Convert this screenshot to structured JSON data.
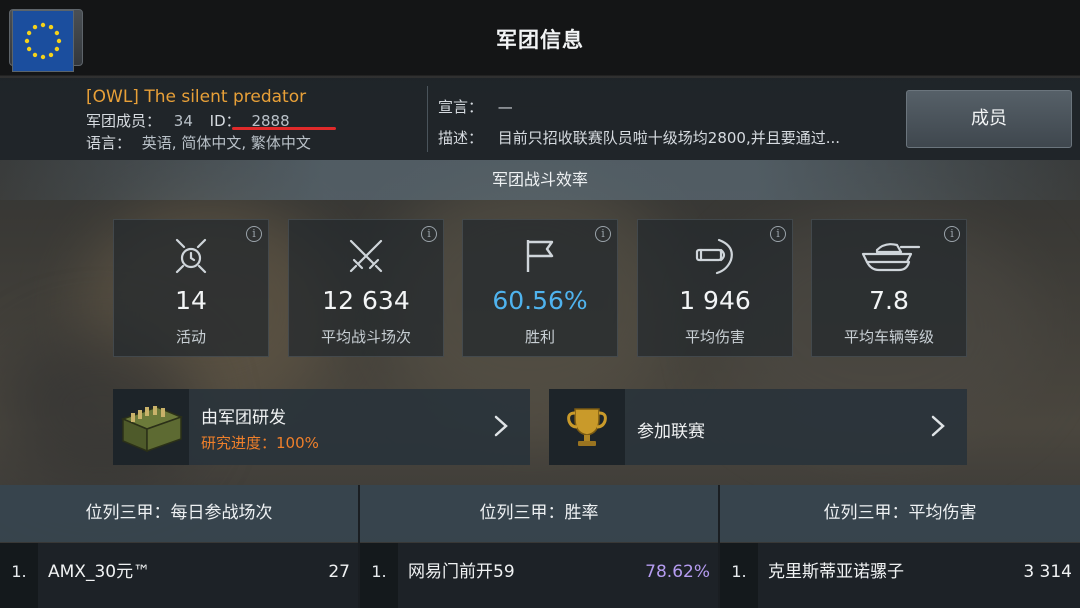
{
  "header": {
    "title": "军团信息"
  },
  "clan": {
    "name": "[OWL] The silent predator",
    "members_label": "军团成员：",
    "members_value": "34",
    "id_label": "ID：",
    "id_value": "2888",
    "language_label": "语言：",
    "language_value": "英语, 简体中文, 繁体中文",
    "declaration_label": "宣言：",
    "declaration_value": "—",
    "description_label": "描述：",
    "description_value": "目前只招收联赛队员啦十级场均2800,并且要通过..."
  },
  "members_button": "成员",
  "section_title": "军团战斗效率",
  "stats": [
    {
      "value": "14",
      "label": "活动",
      "icon": "activity-icon"
    },
    {
      "value": "12 634",
      "label": "平均战斗场次",
      "icon": "crossed-swords-icon"
    },
    {
      "value": "60.56%",
      "label": "胜利",
      "icon": "flag-icon"
    },
    {
      "value": "1 946",
      "label": "平均伤害",
      "icon": "shell-shield-icon"
    },
    {
      "value": "7.8",
      "label": "平均车辆等级",
      "icon": "tank-icon"
    }
  ],
  "info_glyph": "i",
  "research": {
    "title": "由军团研发",
    "progress": "研究进度：100%"
  },
  "league": {
    "title": "参加联赛"
  },
  "leaderboards": [
    {
      "title": "位列三甲：每日参战场次",
      "rank": "1.",
      "name": "AMX_30元™",
      "score": "27"
    },
    {
      "title": "位列三甲：胜率",
      "rank": "1.",
      "name": "网易门前开59",
      "score": "78.62%"
    },
    {
      "title": "位列三甲：平均伤害",
      "rank": "1.",
      "name": "克里斯蒂亚诺骡子",
      "score": "3 314"
    }
  ],
  "colors": {
    "clan_name": "#e8a038",
    "win_rate": "#4fb3ee",
    "research_progress": "#ef7f2a",
    "winrate_score": "#b59cf0",
    "underline": "#e02a2a"
  }
}
